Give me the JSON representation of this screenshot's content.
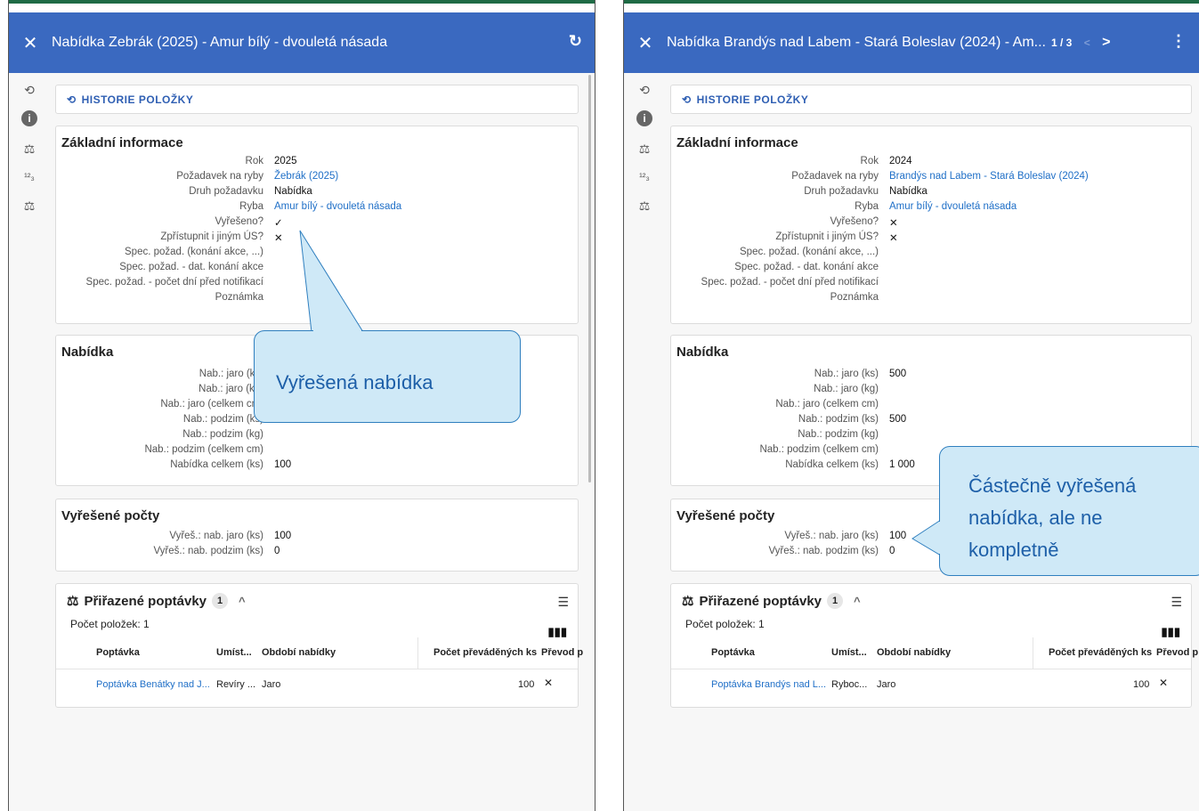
{
  "left": {
    "title": "Nabídka Zebrák (2025) - Amur bílý - dvouletá násada",
    "history_label": "HISTORIE POLOŽKY",
    "basic": {
      "title": "Základní informace",
      "rows": [
        {
          "label": "Rok",
          "value": "2025"
        },
        {
          "label": "Požadavek na ryby",
          "value": "Žebrák (2025)"
        },
        {
          "label": "Druh požadavku",
          "value": "Nabídka"
        },
        {
          "label": "Ryba",
          "value": "Amur bílý - dvouletá násada"
        },
        {
          "label": "Vyřešeno?",
          "value": "✓"
        },
        {
          "label": "Zpřístupnit i jiným ÚS?",
          "value": "✕"
        },
        {
          "label": "Spec. požad. (konání akce, ...)",
          "value": ""
        },
        {
          "label": "Spec. požad. - dat. konání akce",
          "value": ""
        },
        {
          "label": "Spec. požad. - počet dní před notifikací",
          "value": ""
        },
        {
          "label": "Poznámka",
          "value": ""
        }
      ]
    },
    "offer": {
      "title": "Nabídka",
      "rows": [
        {
          "label": "Nab.: jaro (ks)",
          "value": ""
        },
        {
          "label": "Nab.: jaro (kg)",
          "value": ""
        },
        {
          "label": "Nab.: jaro (celkem cm)",
          "value": ""
        },
        {
          "label": "Nab.: podzim (ks)",
          "value": ""
        },
        {
          "label": "Nab.: podzim (kg)",
          "value": ""
        },
        {
          "label": "Nab.: podzim (celkem cm)",
          "value": ""
        },
        {
          "label": "Nabídka celkem (ks)",
          "value": "100"
        }
      ]
    },
    "solved": {
      "title": "Vyřešené počty",
      "rows": [
        {
          "label": "Vyřeš.: nab. jaro (ks)",
          "value": "100"
        },
        {
          "label": "Vyřeš.: nab. podzim (ks)",
          "value": "0"
        }
      ]
    },
    "assigned": {
      "title": "Přiřazené poptávky",
      "badge": "1",
      "count_label": "Počet položek: 1",
      "columns": [
        "Poptávka",
        "Umíst...",
        "Období nabídky",
        "Počet převáděných ks",
        "Převod p"
      ],
      "row": {
        "poptavka": "Poptávka Benátky nad J...",
        "umisteni": "Revíry ...",
        "obdobi": "Jaro",
        "pocet": "100",
        "prevod": "✕"
      }
    },
    "callout": "Vyřešená nabídka"
  },
  "right": {
    "title": "Nabídka Brandýs nad Labem - Stará Boleslav (2024) - Am...",
    "pager": "1 / 3",
    "history_label": "HISTORIE POLOŽKY",
    "basic": {
      "title": "Základní informace",
      "rows": [
        {
          "label": "Rok",
          "value": "2024"
        },
        {
          "label": "Požadavek na ryby",
          "value": "Brandýs nad Labem - Stará Boleslav (2024)"
        },
        {
          "label": "Druh požadavku",
          "value": "Nabídka"
        },
        {
          "label": "Ryba",
          "value": "Amur bílý - dvouletá násada"
        },
        {
          "label": "Vyřešeno?",
          "value": "✕"
        },
        {
          "label": "Zpřístupnit i jiným ÚS?",
          "value": "✕"
        },
        {
          "label": "Spec. požad. (konání akce, ...)",
          "value": ""
        },
        {
          "label": "Spec. požad. - dat. konání akce",
          "value": ""
        },
        {
          "label": "Spec. požad. - počet dní před notifikací",
          "value": ""
        },
        {
          "label": "Poznámka",
          "value": ""
        }
      ]
    },
    "offer": {
      "title": "Nabídka",
      "rows": [
        {
          "label": "Nab.: jaro (ks)",
          "value": "500"
        },
        {
          "label": "Nab.: jaro (kg)",
          "value": ""
        },
        {
          "label": "Nab.: jaro (celkem cm)",
          "value": ""
        },
        {
          "label": "Nab.: podzim (ks)",
          "value": "500"
        },
        {
          "label": "Nab.: podzim (kg)",
          "value": ""
        },
        {
          "label": "Nab.: podzim (celkem cm)",
          "value": ""
        },
        {
          "label": "Nabídka celkem (ks)",
          "value": "1 000"
        }
      ]
    },
    "solved": {
      "title": "Vyřešené počty",
      "rows": [
        {
          "label": "Vyřeš.: nab. jaro (ks)",
          "value": "100"
        },
        {
          "label": "Vyřeš.: nab. podzim (ks)",
          "value": "0"
        }
      ]
    },
    "assigned": {
      "title": "Přiřazené poptávky",
      "badge": "1",
      "count_label": "Počet položek: 1",
      "columns": [
        "Poptávka",
        "Umíst...",
        "Období nabídky",
        "Počet převáděných ks",
        "Převod p"
      ],
      "row": {
        "poptavka": "Poptávka Brandýs nad L...",
        "umisteni": "Ryboc...",
        "obdobi": "Jaro",
        "pocet": "100",
        "prevod": "✕"
      }
    },
    "callout": [
      "Částečně vyřešená",
      "nabídka, ale ne",
      "kompletně"
    ]
  },
  "colors": {
    "header": "#3a69c0",
    "link": "#1f6fc7",
    "callout_fill": "#cfe9f7",
    "callout_border": "#2f7fbf"
  }
}
